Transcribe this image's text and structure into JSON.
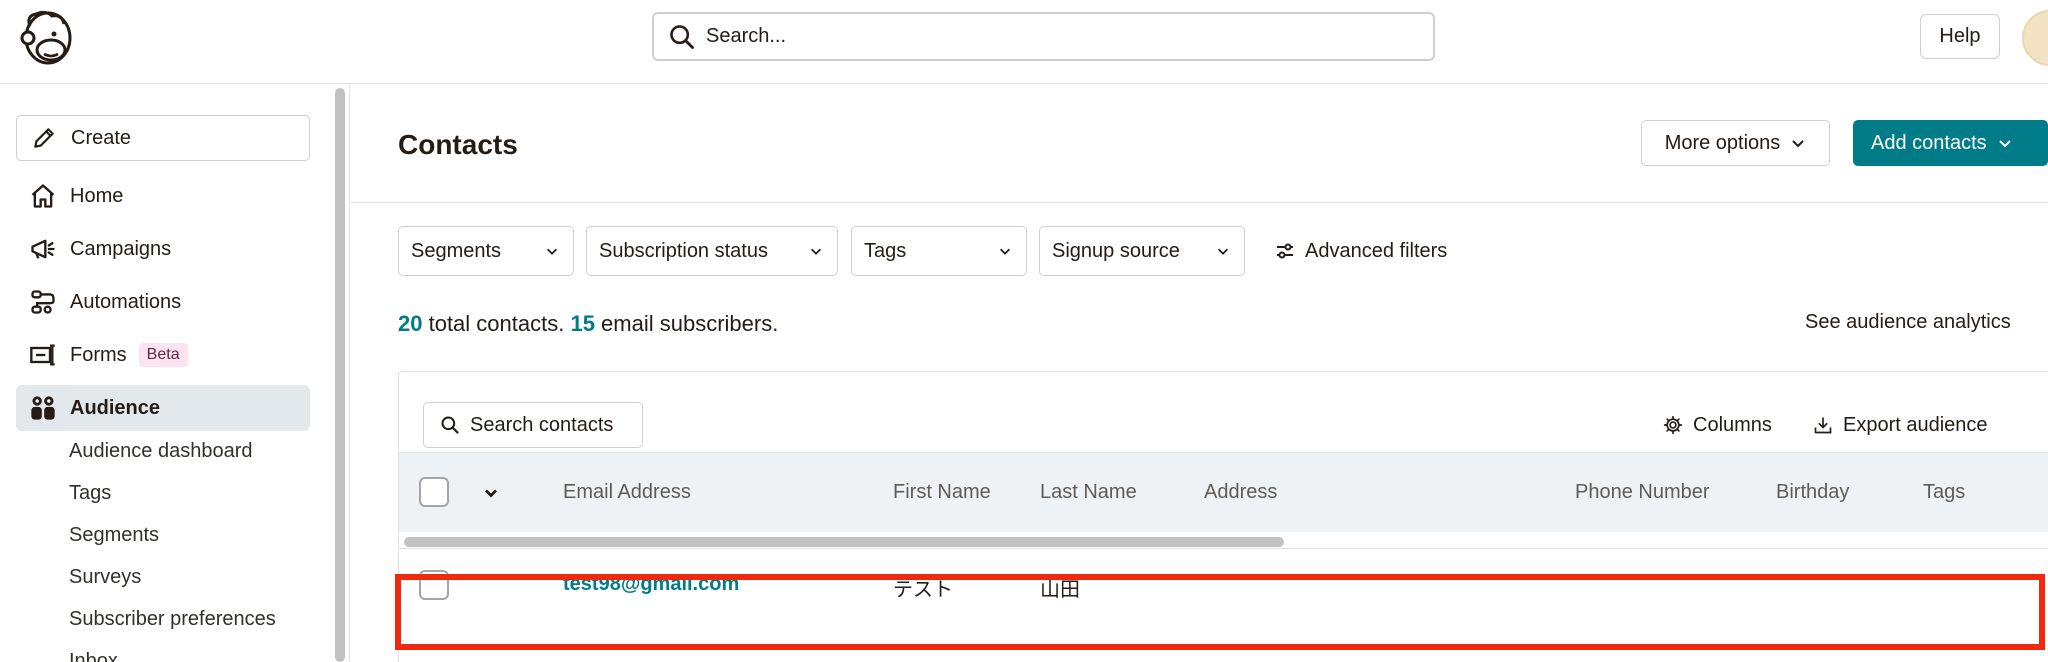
{
  "header": {
    "search_placeholder": "Search...",
    "help_label": "Help"
  },
  "sidebar": {
    "create_label": "Create",
    "items": [
      {
        "label": "Home",
        "icon": "home-icon"
      },
      {
        "label": "Campaigns",
        "icon": "megaphone-icon"
      },
      {
        "label": "Automations",
        "icon": "automation-icon"
      },
      {
        "label": "Forms",
        "icon": "form-icon",
        "badge": "Beta"
      },
      {
        "label": "Audience",
        "icon": "audience-icon",
        "active": true
      }
    ],
    "audience_subitems": [
      "Audience dashboard",
      "Tags",
      "Segments",
      "Surveys",
      "Subscriber preferences",
      "Inbox"
    ]
  },
  "main": {
    "title": "Contacts",
    "more_options_label": "More options",
    "add_contacts_label": "Add contacts",
    "filters": [
      "Segments",
      "Subscription status",
      "Tags",
      "Signup source"
    ],
    "advanced_filters_label": "Advanced filters",
    "summary": {
      "total_count": "20",
      "total_text": " total contacts. ",
      "email_count": "15",
      "email_text": " email subscribers."
    },
    "analytics_link": "See audience analytics",
    "table": {
      "search_label": "Search contacts",
      "columns_label": "Columns",
      "export_label": "Export audience",
      "headers": [
        "Email Address",
        "First Name",
        "Last Name",
        "Address",
        "Phone Number",
        "Birthday",
        "Tags"
      ],
      "rows": [
        {
          "email": "test98@gmail.com",
          "first_name": "テスト",
          "last_name": "山田",
          "address": "",
          "phone": "",
          "birthday": "",
          "tags": ""
        }
      ]
    }
  },
  "colors": {
    "accent": "#007c89",
    "highlight": "#f0280f",
    "active_nav_bg": "#e2e8ec",
    "beta_bg": "#fde2f1"
  }
}
